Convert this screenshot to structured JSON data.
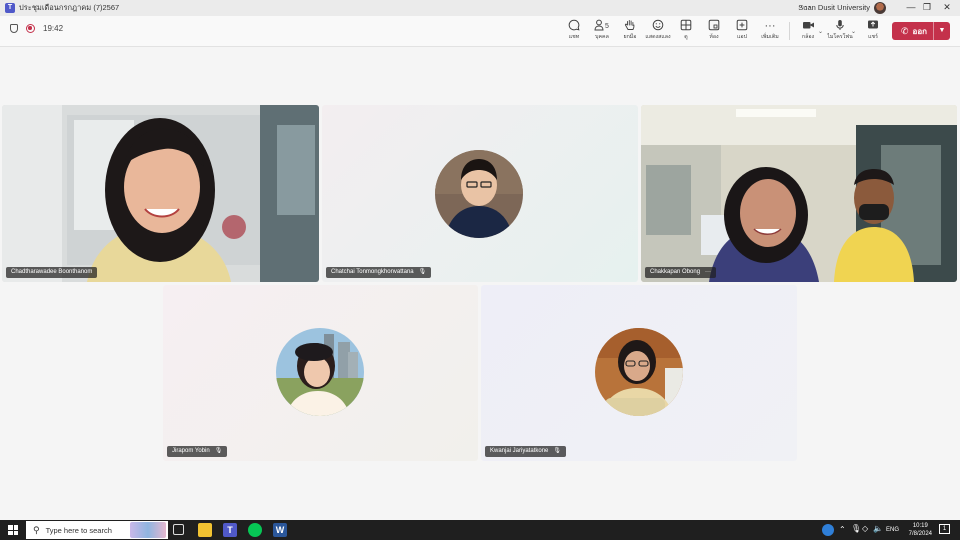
{
  "window": {
    "title": "ประชุมเดือนกรกฎาคม (7)2567",
    "organization": "Suan Dusit University",
    "more_label": "···"
  },
  "toolbar": {
    "elapsed_time": "19:42",
    "items": [
      {
        "label": "แชท",
        "icon": "chat-icon"
      },
      {
        "label": "บุคคล",
        "icon": "people-icon",
        "badge": "5"
      },
      {
        "label": "ยกมือ",
        "icon": "raise-hand-icon"
      },
      {
        "label": "แสดงสแลง",
        "icon": "react-icon"
      },
      {
        "label": "ดู",
        "icon": "view-icon"
      },
      {
        "label": "ห้อง",
        "icon": "rooms-icon"
      },
      {
        "label": "แอป",
        "icon": "apps-icon"
      },
      {
        "label": "เพิ่มเติม",
        "icon": "more-icon"
      },
      {
        "label": "กล้อง",
        "icon": "camera-icon"
      },
      {
        "label": "ไมโครโฟน",
        "icon": "mic-icon"
      },
      {
        "label": "แชร์",
        "icon": "share-icon"
      }
    ],
    "leave_label": "ออก"
  },
  "participants": [
    {
      "name": "Chadtharawadee Boonthanom",
      "video": "on"
    },
    {
      "name": "Chatchai Tonmongkhonvattana",
      "video": "off"
    },
    {
      "name": "Chakkapan Obong",
      "video": "on"
    },
    {
      "name": "Jirapom Yobin",
      "video": "off"
    },
    {
      "name": "Kwanjai Jariyatatkone",
      "video": "off"
    }
  ],
  "taskbar": {
    "search_placeholder": "Type here to search",
    "language": "ENG",
    "time": "10:19",
    "date": "7/8/2024",
    "notification_count": "1"
  }
}
